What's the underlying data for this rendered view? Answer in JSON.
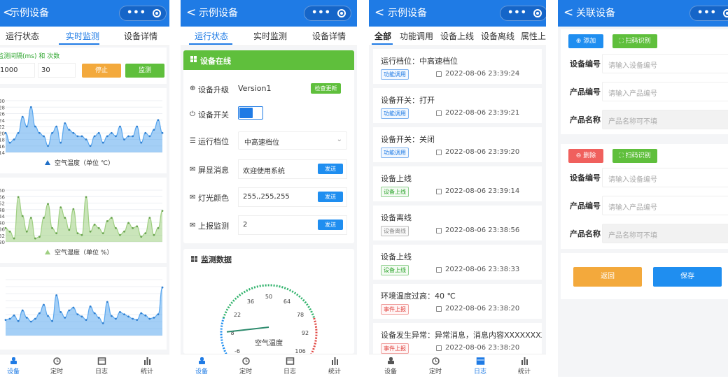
{
  "colors": {
    "primary": "#1f7be5",
    "success": "#5fbf3c",
    "warning": "#f3a93c",
    "danger": "#f0605d",
    "gauge_low": "#1f8ef0",
    "gauge_mid": "#30b26b",
    "gauge_high": "#e0433f"
  },
  "screen1": {
    "title": "示例设备",
    "tabs": [
      "运行状态",
      "实时监测",
      "设备详情"
    ],
    "hint": "监测间隔(ms) 和 次数",
    "interval_value": "1000",
    "count_value": "30",
    "stop_label": "停止",
    "monitor_label": "监测",
    "chart_icon": "triangle-icon",
    "nav": [
      "设备",
      "定时",
      "日志",
      "统计"
    ]
  },
  "screen2": {
    "title": "示例设备",
    "tabs": [
      "运行状态",
      "实时监测",
      "设备详情"
    ],
    "online_header": "设备在线",
    "upgrade_label": "设备升级",
    "version": "Version1",
    "check_update": "检查更新",
    "switch_label": "设备开关",
    "level_label": "运行档位",
    "level_value": "中高速档位",
    "screen_label": "屏显消息",
    "screen_value": "欢迎使用系统",
    "light_label": "灯光颜色",
    "light_value": "255,,255,255",
    "report_label": "上报监测",
    "report_value": "2",
    "send_label": "发送",
    "monitor_header": "监测数据",
    "gauge_label": "空气温度",
    "gauge_ticks": [
      "-6",
      "8",
      "22",
      "36",
      "50",
      "64",
      "78",
      "92",
      "106"
    ],
    "nav": [
      "设备",
      "定时",
      "日志",
      "统计"
    ]
  },
  "screen3": {
    "title": "示例设备",
    "tabs": [
      "全部",
      "功能调用",
      "设备上线",
      "设备离线",
      "属性上报"
    ],
    "logs": [
      {
        "text": "运行档位：中高速档位",
        "tag": "功能调用",
        "color": "blue",
        "time": "2022-08-06 23:39:24"
      },
      {
        "text": "设备开关：打开",
        "tag": "功能调用",
        "color": "blue",
        "time": "2022-08-06 23:39:21"
      },
      {
        "text": "设备开关：关闭",
        "tag": "功能调用",
        "color": "blue",
        "time": "2022-08-06 23:39:20"
      },
      {
        "text": "设备上线",
        "tag": "设备上线",
        "color": "green",
        "time": "2022-08-06 23:39:14"
      },
      {
        "text": "设备离线",
        "tag": "设备离线",
        "color": "gray",
        "time": "2022-08-06 23:38:56"
      },
      {
        "text": "设备上线",
        "tag": "设备上线",
        "color": "green",
        "time": "2022-08-06 23:38:33"
      },
      {
        "text": "环境温度过高：40 ℃",
        "tag": "事件上报",
        "color": "red",
        "time": "2022-08-06 23:38:20"
      },
      {
        "text": "设备发生异常：异常消息，消息内容XXXXXXXX",
        "tag": "事件上报",
        "color": "red",
        "time": "2022-08-06 23:38:20"
      }
    ],
    "nav": [
      "设备",
      "定时",
      "日志",
      "统计"
    ]
  },
  "screen4": {
    "title": "关联设备",
    "add_label": "添加",
    "scan_label": "扫码识别",
    "delete_label": "删除",
    "device_no_label": "设备编号",
    "device_no_placeholder": "请输入设备编号",
    "product_no_label": "产品编号",
    "product_no_placeholder": "请输入产品编号",
    "product_name_label": "产品名称",
    "product_name_placeholder": "产品名称可不填",
    "back_label": "返回",
    "save_label": "保存"
  },
  "chart_data": [
    {
      "type": "area",
      "title": "空气温度（单位 ℃）",
      "legend": "空气温度（单位 ℃）",
      "y_ticks": [
        "30",
        "28",
        "26",
        "24",
        "22",
        "20",
        "18",
        "16",
        "14"
      ],
      "ylim": [
        14,
        30
      ],
      "color": "#5aa7ef",
      "values": [
        20,
        17,
        18,
        20,
        25,
        22,
        28,
        22,
        20,
        19,
        16,
        20,
        22,
        17,
        23,
        21,
        20,
        19,
        19,
        18,
        16,
        19,
        20,
        17,
        19,
        20,
        19,
        22,
        18,
        19,
        19,
        22,
        17,
        20,
        19,
        21,
        24,
        20
      ]
    },
    {
      "type": "area",
      "title": "空气湿度（单位 %）",
      "legend": "空气湿度（单位 %）",
      "y_ticks": [
        "60",
        "56",
        "52",
        "48",
        "44",
        "40",
        "36",
        "32",
        "30"
      ],
      "ylim": [
        30,
        60
      ],
      "color": "#9fcf82",
      "values": [
        38,
        36,
        32,
        56,
        45,
        36,
        44,
        32,
        33,
        44,
        52,
        38,
        35,
        50,
        44,
        37,
        49,
        35,
        34,
        56,
        36,
        40,
        38,
        35,
        42,
        44,
        38,
        34,
        36,
        41,
        38,
        39,
        33,
        35,
        44,
        34,
        38,
        48
      ]
    },
    {
      "type": "area",
      "title": "",
      "legend": "",
      "y_ticks": [
        "",
        "",
        "",
        "",
        "",
        "",
        "",
        "",
        ""
      ],
      "ylim": [
        0,
        100
      ],
      "color": "#5aa7ef",
      "values": [
        28,
        30,
        36,
        26,
        45,
        32,
        25,
        30,
        40,
        55,
        35,
        26,
        72,
        42,
        32,
        45,
        50,
        38,
        34,
        28,
        52,
        40,
        32,
        22,
        60,
        35,
        30,
        42,
        38,
        34,
        30,
        28,
        40,
        36,
        30,
        32,
        38,
        86
      ]
    }
  ]
}
